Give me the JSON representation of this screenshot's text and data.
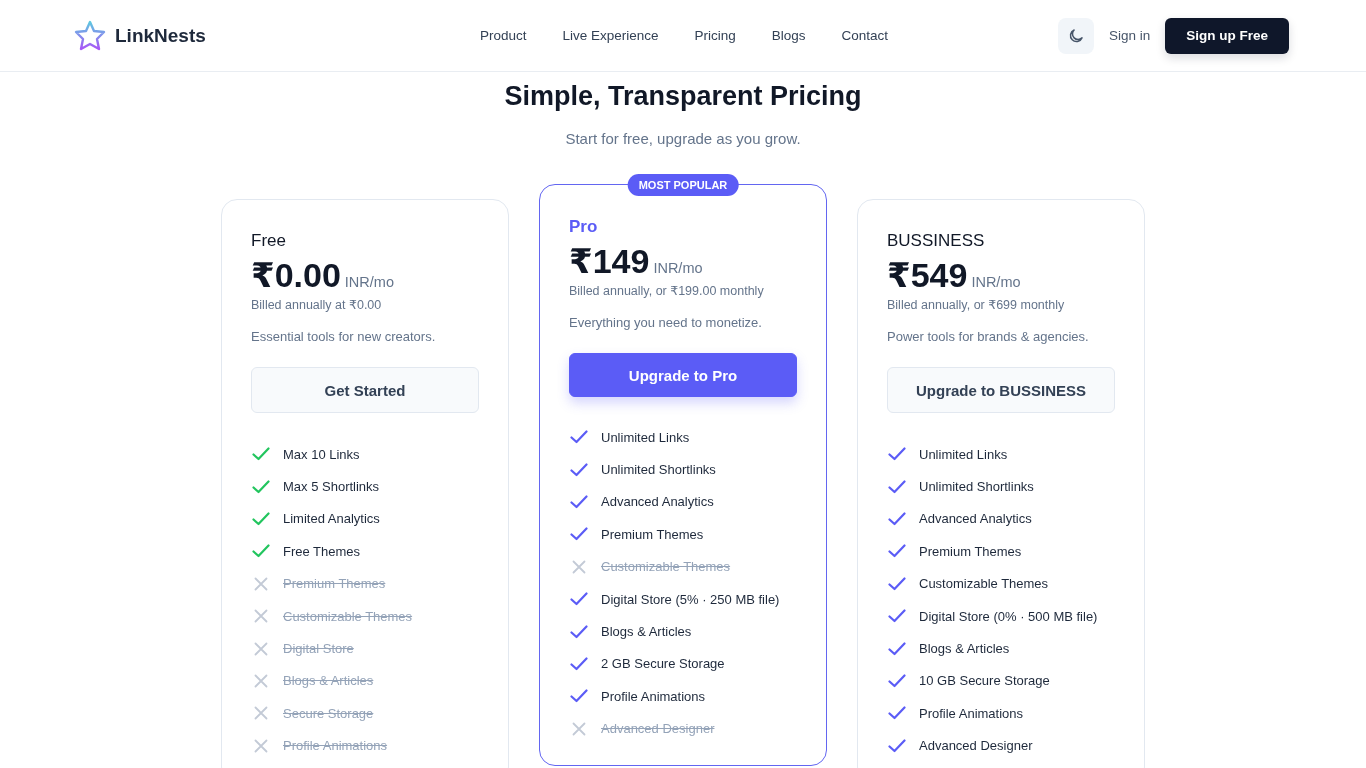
{
  "header": {
    "brand": "LinkNests",
    "nav": [
      {
        "label": "Product"
      },
      {
        "label": "Live Experience"
      },
      {
        "label": "Pricing"
      },
      {
        "label": "Blogs"
      },
      {
        "label": "Contact"
      }
    ],
    "sign_in": "Sign in",
    "sign_up": "Sign up Free"
  },
  "heading": "Simple, Transparent Pricing",
  "subheading": "Start for free, upgrade as you grow.",
  "plans": [
    {
      "name": "Free",
      "featured": false,
      "color": "#22c55e",
      "price": "₹0.00",
      "unit": "INR/mo",
      "billing": "Billed annually at ₹0.00",
      "description": "Essential tools for new creators.",
      "button": "Get Started",
      "features": [
        {
          "label": "Max 10 Links",
          "included": true
        },
        {
          "label": "Max 5 Shortlinks",
          "included": true
        },
        {
          "label": "Limited Analytics",
          "included": true
        },
        {
          "label": "Free Themes",
          "included": true
        },
        {
          "label": "Premium Themes",
          "included": false
        },
        {
          "label": "Customizable Themes",
          "included": false
        },
        {
          "label": "Digital Store",
          "included": false
        },
        {
          "label": "Blogs & Articles",
          "included": false
        },
        {
          "label": "Secure Storage",
          "included": false
        },
        {
          "label": "Profile Animations",
          "included": false
        }
      ]
    },
    {
      "name": "Pro",
      "featured": true,
      "badge": "MOST POPULAR",
      "color": "#5b5cf6",
      "price": "₹149",
      "unit": "INR/mo",
      "billing": "Billed annually, or ₹199.00 monthly",
      "description": "Everything you need to monetize.",
      "button": "Upgrade to Pro",
      "features": [
        {
          "label": "Unlimited Links",
          "included": true
        },
        {
          "label": "Unlimited Shortlinks",
          "included": true
        },
        {
          "label": "Advanced Analytics",
          "included": true
        },
        {
          "label": "Premium Themes",
          "included": true
        },
        {
          "label": "Customizable Themes",
          "included": false
        },
        {
          "label": "Digital Store (5% · 250 MB file)",
          "included": true
        },
        {
          "label": "Blogs & Articles",
          "included": true
        },
        {
          "label": "2 GB Secure Storage",
          "included": true
        },
        {
          "label": "Profile Animations",
          "included": true
        },
        {
          "label": "Advanced Designer",
          "included": false
        }
      ]
    },
    {
      "name": "BUSSINESS",
      "featured": false,
      "color": "#5b5cf6",
      "price": "₹549",
      "unit": "INR/mo",
      "billing": "Billed annually, or ₹699 monthly",
      "description": "Power tools for brands & agencies.",
      "button": "Upgrade to BUSSINESS",
      "features": [
        {
          "label": "Unlimited Links",
          "included": true
        },
        {
          "label": "Unlimited Shortlinks",
          "included": true
        },
        {
          "label": "Advanced Analytics",
          "included": true
        },
        {
          "label": "Premium Themes",
          "included": true
        },
        {
          "label": "Customizable Themes",
          "included": true
        },
        {
          "label": "Digital Store (0% · 500 MB file)",
          "included": true
        },
        {
          "label": "Blogs & Articles",
          "included": true
        },
        {
          "label": "10 GB Secure Storage",
          "included": true
        },
        {
          "label": "Profile Animations",
          "included": true
        },
        {
          "label": "Advanced Designer",
          "included": true
        }
      ]
    }
  ]
}
